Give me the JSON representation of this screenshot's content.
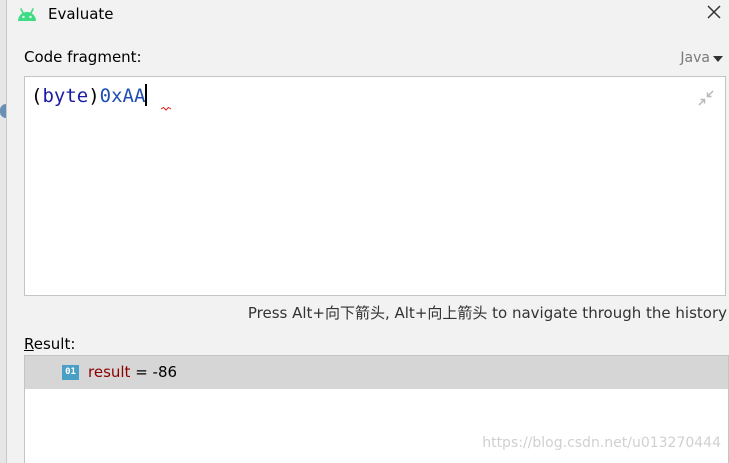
{
  "window": {
    "title": "Evaluate",
    "icon": "android-icon",
    "close_icon": "close-icon"
  },
  "code_fragment": {
    "label": "Code fragment:",
    "language": "Java",
    "code": {
      "open_paren": "(",
      "keyword": "byte",
      "close_paren": ")",
      "literal": "0xAA"
    }
  },
  "history_hint": "Press Alt+向下箭头, Alt+向上箭头 to navigate through the history",
  "result": {
    "label_mnemonic": "R",
    "label_rest": "esult:",
    "items": [
      {
        "type_badge": "01",
        "name": "result",
        "equals": " = ",
        "value": "-86"
      }
    ]
  },
  "watermark": "https://blog.csdn.net/u013270444",
  "colors": {
    "android_green": "#3ddc84",
    "keyword": "#1a1aa6",
    "literal": "#1f4fb3",
    "var_name": "#8b0000",
    "badge": "#4a9fc7",
    "selected_row": "#d6d6d6"
  }
}
